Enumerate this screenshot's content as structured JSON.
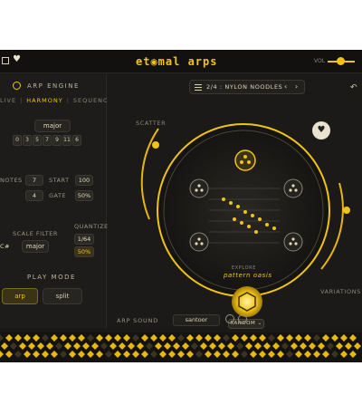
{
  "brand": "et◉mal arps",
  "vol_label": "VOL",
  "arp_engine": {
    "title": "ARP ENGINE",
    "tabs": [
      "LIVE",
      "HARMONY",
      "SEQUENCE"
    ],
    "active_tab": "HARMONY"
  },
  "harmony": {
    "scale": "major",
    "degrees": [
      "0",
      "3",
      "5",
      "7",
      "9",
      "11",
      "6"
    ],
    "notes_label": "NOTES",
    "notes_value": "7",
    "start_label": "START",
    "start_value": "100",
    "row2_value": "4",
    "gate_label": "GATE",
    "gate_value": "50%"
  },
  "scale_filter": {
    "label": "SCALE FILTER",
    "key": "C#",
    "scale": "major"
  },
  "quantize": {
    "label": "QUANTIZE",
    "value": "1/64",
    "swing": "50%"
  },
  "play_mode": {
    "title": "PLAY MODE",
    "arp": "arp",
    "split": "split",
    "active": "arp"
  },
  "preset": {
    "text": "2/4 : NYLON NOODLES"
  },
  "labels": {
    "scatter": "SCATTER",
    "variations": "VARIATIONS",
    "explore": "EXPLORE",
    "pattern": "pattern oasis",
    "random": "RANDOM"
  },
  "sound": {
    "label": "ARP SOUND",
    "value": "santoor"
  },
  "colors": {
    "accent": "#f2c313",
    "bg": "#1a1917",
    "panel": "#1d1c1a"
  }
}
